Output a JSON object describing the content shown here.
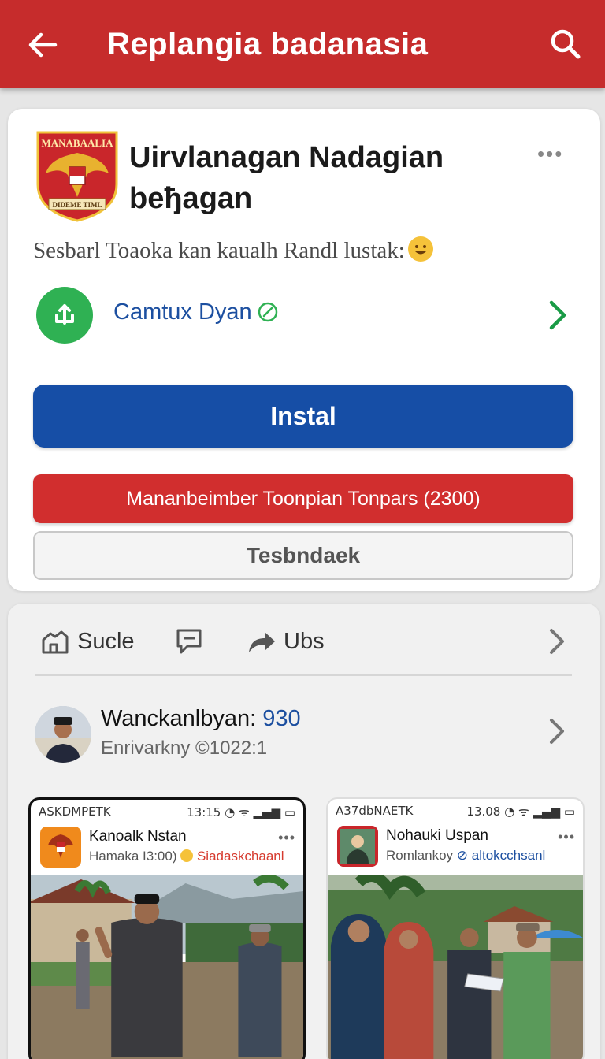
{
  "appbar": {
    "title": "Replangia badanasia",
    "back_icon": "arrow-left-icon",
    "search_icon": "search-icon",
    "background": "#c62c2c"
  },
  "app": {
    "title": "Uirvlanagan Nadagian beђagan",
    "logo_text_top": "MANABAALIA",
    "logo_text_bottom": "DIDEME TIML",
    "more_label": "•••",
    "description": "Sesbarl Toaoka kan kaualh Randl lustak:",
    "developer": {
      "name": "Camtux Dyan",
      "icon": "anchor-icon",
      "verified_icon": "verified-icon"
    },
    "install_label": "Instal",
    "secondary_label": "Mananbeimber Toonpian Tonpars (2300)",
    "outline_label": "Tesbndaek",
    "colors": {
      "install": "#164ea6",
      "secondary": "#d12e2e",
      "dev_icon": "#2fb153"
    }
  },
  "feed": {
    "actions": [
      {
        "label": "Sucle",
        "icon": "home-icon"
      },
      {
        "label": "",
        "icon": "comment-icon"
      },
      {
        "label": "Ubs",
        "icon": "share-icon"
      }
    ],
    "post": {
      "name": "Wanckanlbyan:",
      "name_number": "930",
      "meta": "Enrivarkny ©1022:1"
    },
    "phones": [
      {
        "status_left": "ASKDMPETK",
        "status_time": "13:15",
        "name": "Kanoalk Nstan",
        "sub": "Hamaka I3:00)",
        "sub_accent": "Siadaskchaanl",
        "dots": "•••"
      },
      {
        "status_left": "A37dbNAETK",
        "status_time": "13.08",
        "name": "Nohauki Uspan",
        "sub": "Romlankoy",
        "sub_accent": "altokcchsanl",
        "dots": "•••"
      }
    ]
  }
}
